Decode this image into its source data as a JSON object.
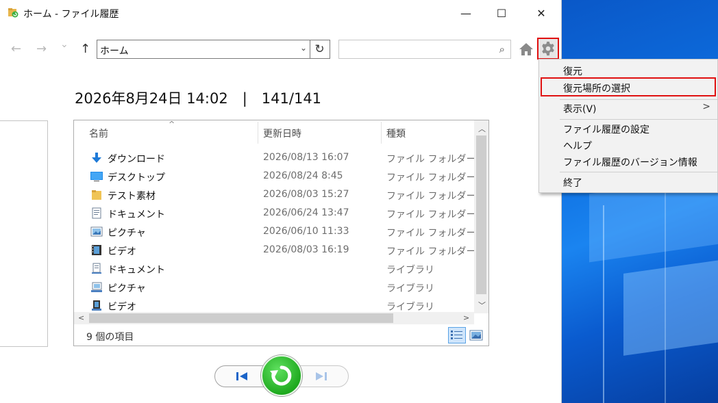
{
  "window": {
    "title": "ホーム - ファイル履歴",
    "minimize": "—",
    "maximize": "☐",
    "close": "✕"
  },
  "nav": {
    "back": "←",
    "forward": "→",
    "dropdown": "⌄",
    "up": "↑",
    "address": "ホーム",
    "address_dropdown": "⌄",
    "refresh": "↻",
    "search_placeholder": "",
    "search_icon": "⌕"
  },
  "datetime": "2026年8月24日 14:02　|　141/141",
  "columns": {
    "name": "名前",
    "modified": "更新日時",
    "type": "種類",
    "sort_indicator": "^"
  },
  "files": [
    {
      "name": "ダウンロード",
      "date": "2026/08/13 16:07",
      "type": "ファイル フォルダー",
      "icon": "download-icon"
    },
    {
      "name": "デスクトップ",
      "date": "2026/08/24 8:45",
      "type": "ファイル フォルダー",
      "icon": "desktop-icon"
    },
    {
      "name": "テスト素材",
      "date": "2026/08/03 15:27",
      "type": "ファイル フォルダー",
      "icon": "folder-icon"
    },
    {
      "name": "ドキュメント",
      "date": "2026/06/24 13:47",
      "type": "ファイル フォルダー",
      "icon": "document-icon"
    },
    {
      "name": "ピクチャ",
      "date": "2026/06/10 11:33",
      "type": "ファイル フォルダー",
      "icon": "picture-icon"
    },
    {
      "name": "ビデオ",
      "date": "2026/08/03 16:19",
      "type": "ファイル フォルダー",
      "icon": "video-icon"
    },
    {
      "name": "ドキュメント",
      "date": "",
      "type": "ライブラリ",
      "icon": "document-library-icon"
    },
    {
      "name": "ピクチャ",
      "date": "",
      "type": "ライブラリ",
      "icon": "picture-library-icon"
    },
    {
      "name": "ビデオ",
      "date": "",
      "type": "ライブラリ",
      "icon": "video-library-icon"
    }
  ],
  "status": {
    "item_count": "9 個の項目"
  },
  "menu": {
    "restore": "復元",
    "select_location": "復元場所の選択",
    "view": "表示(V)",
    "view_chevron": ">",
    "settings": "ファイル履歴の設定",
    "help": "ヘルプ",
    "version": "ファイル履歴のバージョン情報",
    "exit": "終了"
  },
  "colors": {
    "highlight_border": "#e01010",
    "restore_green": "#1faa1f",
    "desktop_blue": "#0e6fe0"
  }
}
